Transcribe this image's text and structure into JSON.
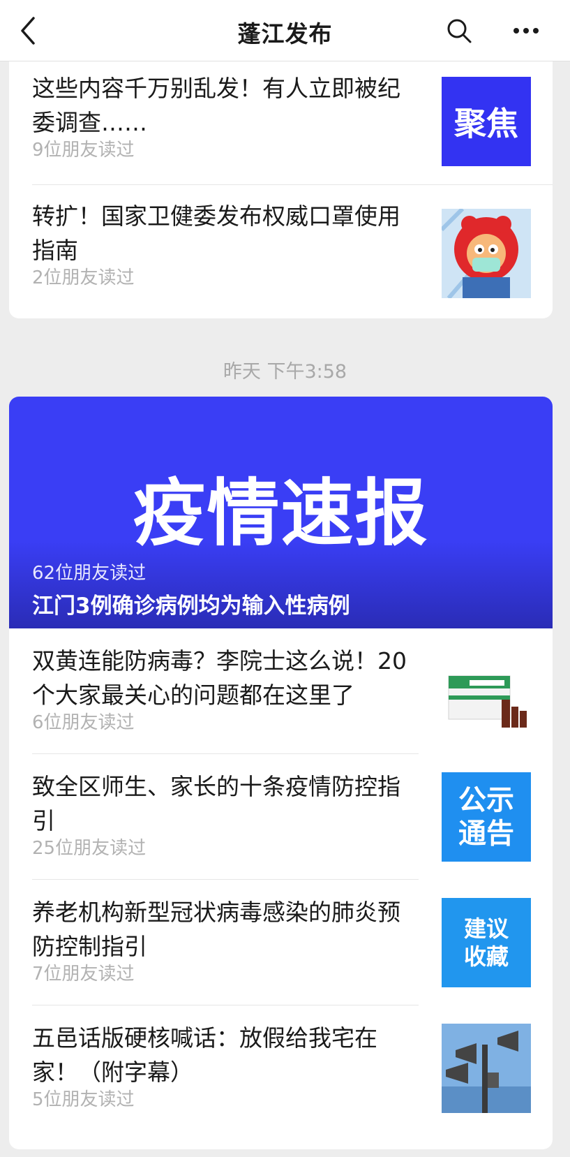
{
  "nav": {
    "title": "蓬江发布"
  },
  "feed_top": [
    {
      "title": "这些内容千万别乱发！有人立即被纪委调查……",
      "reads": "9位朋友读过",
      "thumb_text": "聚焦",
      "thumb_color": "#3333f2"
    },
    {
      "title": "转扩！国家卫健委发布权威口罩使用指南",
      "reads": "2位朋友读过"
    }
  ],
  "timestamp": "昨天 下午3:58",
  "hero": {
    "cover_text": "疫情速报",
    "reads": "62位朋友读过",
    "title": "江门3例确诊病例均为输入性病例",
    "color": "#3a3ef5"
  },
  "feed_bottom": [
    {
      "title": "双黄连能防病毒？李院士这么说！20个大家最关心的问题都在这里了",
      "reads": "6位朋友读过"
    },
    {
      "title": "致全区师生、家长的十条疫情防控指引",
      "reads": "25位朋友读过",
      "thumb_text_1": "公示",
      "thumb_text_2": "通告",
      "thumb_color": "#1f8ff0"
    },
    {
      "title": "养老机构新型冠状病毒感染的肺炎预防控制指引",
      "reads": "7位朋友读过",
      "thumb_text_1": "建议",
      "thumb_text_2": "收藏",
      "thumb_color": "#2196ee"
    },
    {
      "title": "五邑话版硬核喊话：放假给我宅在家！（附字幕）",
      "reads": "5位朋友读过"
    }
  ]
}
